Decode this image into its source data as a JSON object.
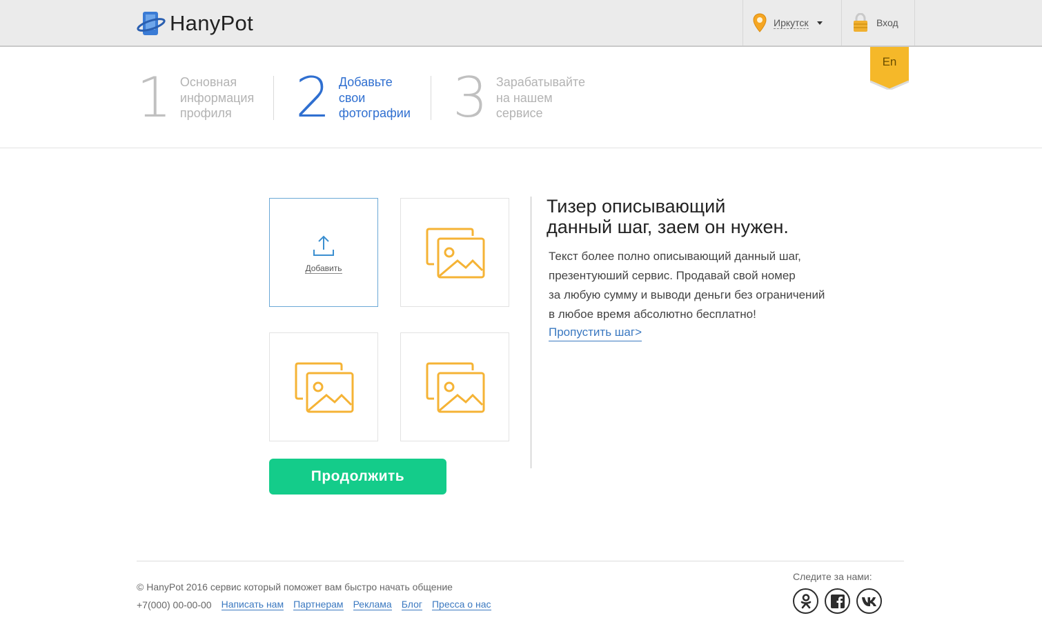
{
  "header": {
    "logo_text": "HanyPot",
    "city": "Иркутск",
    "login": "Вход",
    "lang": "En",
    "colors": {
      "background": "#ebebeb",
      "pin": "#f5a623",
      "lock": "#f0b030"
    }
  },
  "steps": [
    {
      "num": "1",
      "lines": [
        "Основная",
        "информация",
        "профиля"
      ],
      "active": false
    },
    {
      "num": "2",
      "lines": [
        "Добавьте",
        "свои",
        "фотографии"
      ],
      "active": true
    },
    {
      "num": "3",
      "lines": [
        "Зарабатывайте",
        "на нашем",
        "сервисе"
      ],
      "active": false
    }
  ],
  "upload": {
    "label": "Добавить",
    "icon": "upload-icon"
  },
  "photo_placeholder_icon": "image-placeholder-icon",
  "continue_label": "Продолжить",
  "teaser": {
    "title_line1": "Тизер описывающий",
    "title_line2": "данный шаг, заем он нужен.",
    "text_lines": [
      "Текст более полно описывающий данный шаг,",
      "презентуюший сервис. Продавай свой номер",
      "за любую сумму и выводи деньги без ограничений",
      "в любое время абсолютно бесплатно!"
    ],
    "skip": "Пропустить шаг>"
  },
  "footer": {
    "copyright": "© HanyPot 2016 сервис который поможет вам быстро начать общение",
    "phone": "+7(000) 00-00-00",
    "links": [
      "Написать нам",
      "Партнерам",
      "Реклама",
      "Блог",
      "Пресса о нас"
    ],
    "follow": "Следите за нами:",
    "social": [
      "odnoklassniki-icon",
      "facebook-icon",
      "vk-icon"
    ]
  },
  "colors": {
    "accent": "#2f6fd0",
    "button": "#14cc8a",
    "placeholder": "#f5b335",
    "link": "#3a78c0"
  }
}
